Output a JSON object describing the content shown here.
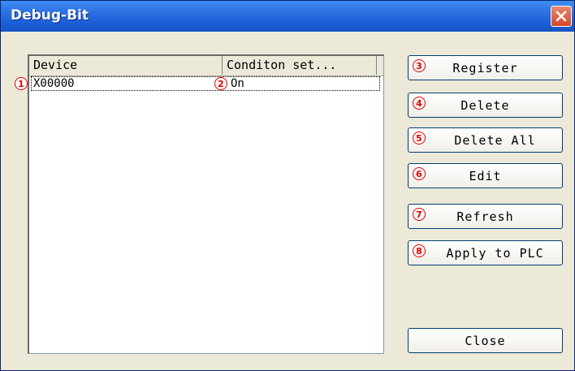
{
  "window": {
    "title": "Debug-Bit"
  },
  "list": {
    "columns": [
      "Device",
      "Conditon set..."
    ],
    "rows": [
      {
        "device": "X00000",
        "condition": "On"
      }
    ]
  },
  "markers": {
    "m1": "1",
    "m2": "2",
    "m3": "3",
    "m4": "4",
    "m5": "5",
    "m6": "6",
    "m7": "7",
    "m8": "8"
  },
  "buttons": {
    "register": "Register",
    "delete": "Delete",
    "delete_all": "Delete All",
    "edit": "Edit",
    "refresh": "Refresh",
    "apply": "Apply to PLC",
    "close": "Close"
  },
  "colors": {
    "title_bar": "#2b6fe0",
    "marker": "#e00000",
    "close_button": "#d5452a"
  }
}
